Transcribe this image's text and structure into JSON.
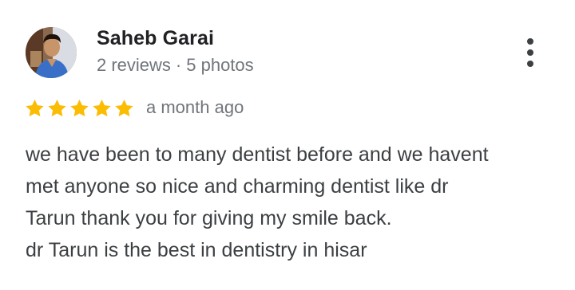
{
  "reviewer": {
    "name": "Saheb Garai",
    "reviews": "2 reviews",
    "separator": "·",
    "photos": "5 photos"
  },
  "review": {
    "rating": 5,
    "max_rating": 5,
    "time": "a month ago",
    "text_lines": [
      "we have been to many dentist before and we havent",
      "met anyone so nice and charming dentist like dr",
      "Tarun thank you for giving my smile back.",
      "dr Tarun is the best in dentistry in hisar"
    ]
  },
  "colors": {
    "star": "#fbbc04",
    "name": "#202124",
    "meta": "#70757a",
    "body": "#3c4043"
  },
  "icons": {
    "more": "more-vert-icon",
    "star": "star-icon"
  }
}
